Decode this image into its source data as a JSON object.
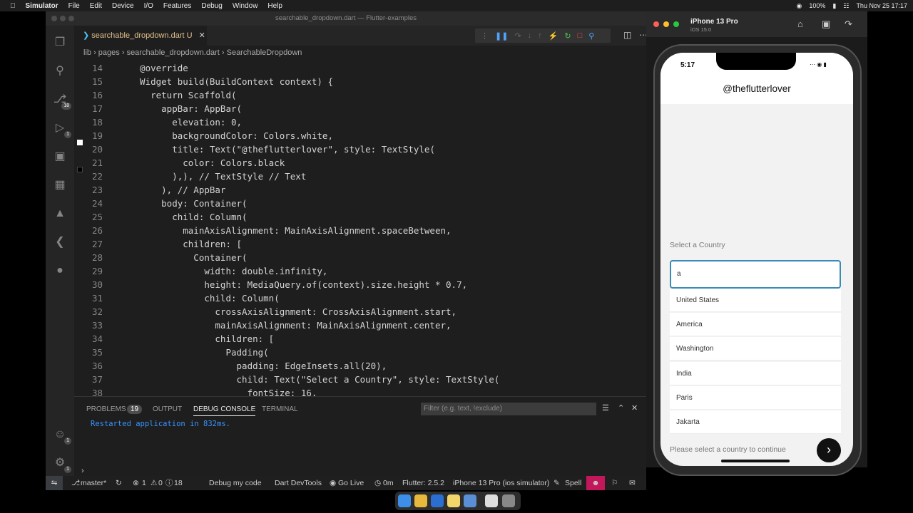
{
  "menubar": {
    "app": "Simulator",
    "items": [
      "File",
      "Edit",
      "Device",
      "I/O",
      "Features",
      "Debug",
      "Window",
      "Help"
    ],
    "battery": "100%",
    "datetime": "Thu Nov 25  17:17"
  },
  "vscode": {
    "window_title": "searchable_dropdown.dart — Flutter-examples",
    "tab_label": "searchable_dropdown.dart",
    "tab_status": "U",
    "breadcrumb": [
      "lib",
      "pages",
      "searchable_dropdown.dart",
      "SearchableDropdown"
    ],
    "activity_badges": {
      "scm": "18",
      "debug": "1",
      "accounts": "1",
      "settings": "1"
    },
    "code_lines": [
      {
        "n": "14",
        "text": "  @override"
      },
      {
        "n": "15",
        "text": "  Widget build(BuildContext context) {"
      },
      {
        "n": "16",
        "text": "    return Scaffold("
      },
      {
        "n": "17",
        "text": "      appBar: AppBar("
      },
      {
        "n": "18",
        "text": "        elevation: 0,"
      },
      {
        "n": "19",
        "text": "        backgroundColor: Colors.white,"
      },
      {
        "n": "20",
        "text": "        title: Text(\"@theflutterlover\", style: TextStyle("
      },
      {
        "n": "21",
        "text": "          color: Colors.black"
      },
      {
        "n": "22",
        "text": "        ),), // TextStyle // Text"
      },
      {
        "n": "23",
        "text": "      ), // AppBar"
      },
      {
        "n": "24",
        "text": "      body: Container("
      },
      {
        "n": "25",
        "text": "        child: Column("
      },
      {
        "n": "26",
        "text": "          mainAxisAlignment: MainAxisAlignment.spaceBetween,"
      },
      {
        "n": "27",
        "text": "          children: ["
      },
      {
        "n": "28",
        "text": "            Container("
      },
      {
        "n": "29",
        "text": "              width: double.infinity,"
      },
      {
        "n": "30",
        "text": "              height: MediaQuery.of(context).size.height * 0.7,"
      },
      {
        "n": "31",
        "text": "              child: Column("
      },
      {
        "n": "32",
        "text": "                crossAxisAlignment: CrossAxisAlignment.start,"
      },
      {
        "n": "33",
        "text": "                mainAxisAlignment: MainAxisAlignment.center,"
      },
      {
        "n": "34",
        "text": "                children: ["
      },
      {
        "n": "35",
        "text": "                  Padding("
      },
      {
        "n": "36",
        "text": "                    padding: EdgeInsets.all(20),"
      },
      {
        "n": "37",
        "text": "                    child: Text(\"Select a Country\", style: TextStyle("
      },
      {
        "n": "38",
        "text": "                      fontSize: 16,"
      }
    ],
    "panel": {
      "tabs": [
        "PROBLEMS",
        "OUTPUT",
        "DEBUG CONSOLE",
        "TERMINAL"
      ],
      "problems_count": "19",
      "filter_placeholder": "Filter (e.g. text, !exclude)",
      "console_output": "Restarted application in 832ms."
    },
    "statusbar": {
      "branch": "master*",
      "errors": "1",
      "warnings": "0",
      "infos": "18",
      "debug_label": "Debug my code",
      "devtools": "Dart DevTools",
      "golive": "Go Live",
      "time": "0m",
      "flutter": "Flutter: 2.5.2",
      "device": "iPhone 13 Pro (ios simulator)",
      "spell": "Spell"
    }
  },
  "simulator": {
    "device_name": "iPhone 13 Pro",
    "ios_version": "iOS 15.0",
    "status_time": "5:17",
    "app_title": "@theflutterlover",
    "section_label": "Select a Country",
    "search_value": "a",
    "results": [
      "United States",
      "America",
      "Washington",
      "India",
      "Paris",
      "Jakarta"
    ],
    "footer_text": "Please select a country to continue"
  }
}
